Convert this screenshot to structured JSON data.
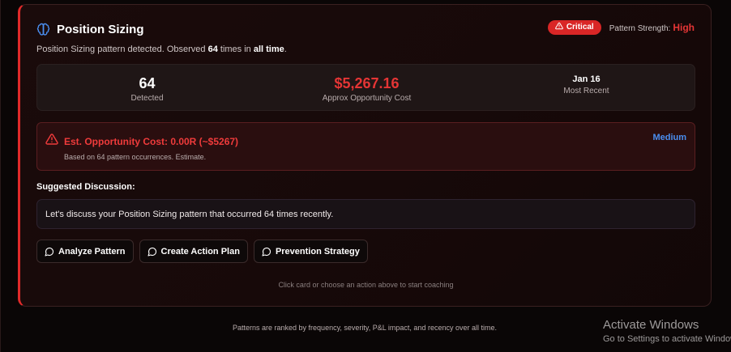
{
  "card": {
    "title": "Position Sizing",
    "badge_label": "Critical",
    "strength_label": "Pattern Strength:",
    "strength_value": "High",
    "subtitle": {
      "prefix": "Position Sizing pattern detected. Observed ",
      "count": "64",
      "middle": " times in ",
      "range": "all time",
      "suffix": "."
    },
    "stats": [
      {
        "value": "64",
        "label": "Detected"
      },
      {
        "value": "$5,267.16",
        "label": "Approx Opportunity Cost"
      },
      {
        "value": "Jan 16",
        "label": "Most Recent"
      }
    ],
    "alert": {
      "title": "Est. Opportunity Cost: 0.00R (~$5267)",
      "subtitle": "Based on 64 pattern occurrences. Estimate.",
      "level": "Medium"
    },
    "discussion_label": "Suggested Discussion:",
    "discussion_text": "Let's discuss your Position Sizing pattern that occurred 64 times recently.",
    "actions": [
      "Analyze Pattern",
      "Create Action Plan",
      "Prevention Strategy"
    ],
    "hint": "Click card or choose an action above to start coaching"
  },
  "footer": "Patterns are ranked by frequency, severity, P&L impact, and recency over all time.",
  "watermark": {
    "title": "Activate Windows",
    "subtitle": "Go to Settings to activate Windows."
  },
  "icons": {
    "title_icon": "brain-icon",
    "badge_icon": "warning-triangle-icon",
    "alert_icon": "warning-triangle-icon",
    "action_icon": "chat-bubble-icon"
  },
  "colors": {
    "accent_red": "#e53535",
    "critical_badge": "#d92626",
    "medium_blue": "#4a8ef0",
    "card_border": "#e02a2a"
  }
}
